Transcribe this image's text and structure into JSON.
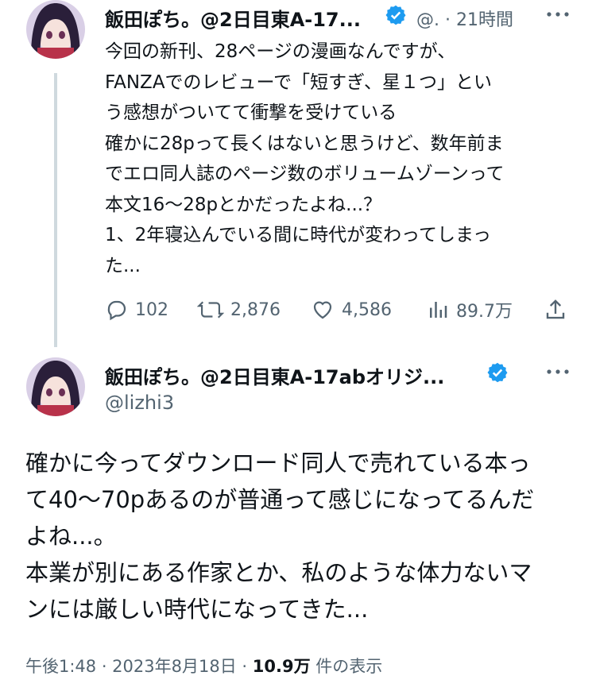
{
  "tweet1": {
    "display_name": "飯田ぽち。@2日目東A-17...",
    "handle": "@.",
    "separator": "·",
    "time": "21時間",
    "text_lines": [
      "今回の新刊、28ページの漫画なんですが、",
      "FANZAでのレビューで「短すぎ、星１つ」とい",
      "う感想がついてて衝撃を受けている",
      "確かに28pって長くはないと思うけど、数年前ま",
      "でエロ同人誌のページ数のボリュームゾーンって",
      "本文16〜28pとかだったよね...？",
      "1、2年寝込んでいる間に時代が変わってしまっ",
      "た..."
    ],
    "replies": "102",
    "retweets": "2,876",
    "likes": "4,586",
    "views": "89.7万"
  },
  "tweet2": {
    "display_name": "飯田ぽち。@2日目東A-17abオリジ...",
    "handle": "@lizhi3",
    "text_lines": [
      "確かに今ってダウンロード同人で売れている本っ",
      "て40〜70pあるのが普通って感じになってるんだ",
      "よね...。",
      "本業が別にある作家とか、私のような体力ないマ",
      "ンには厳しい時代になってきた..."
    ],
    "timestamp": "午後1:48 · 2023年8月18日 · ",
    "view_count": "10.9万",
    "view_label": "件の表示"
  },
  "colors": {
    "verified": "#1d9bf0",
    "secondary": "#536471",
    "thread_line": "#cfd9de"
  },
  "icons": [
    "verified-badge-icon",
    "more-icon",
    "reply-icon",
    "retweet-icon",
    "like-icon",
    "views-icon",
    "share-icon"
  ]
}
